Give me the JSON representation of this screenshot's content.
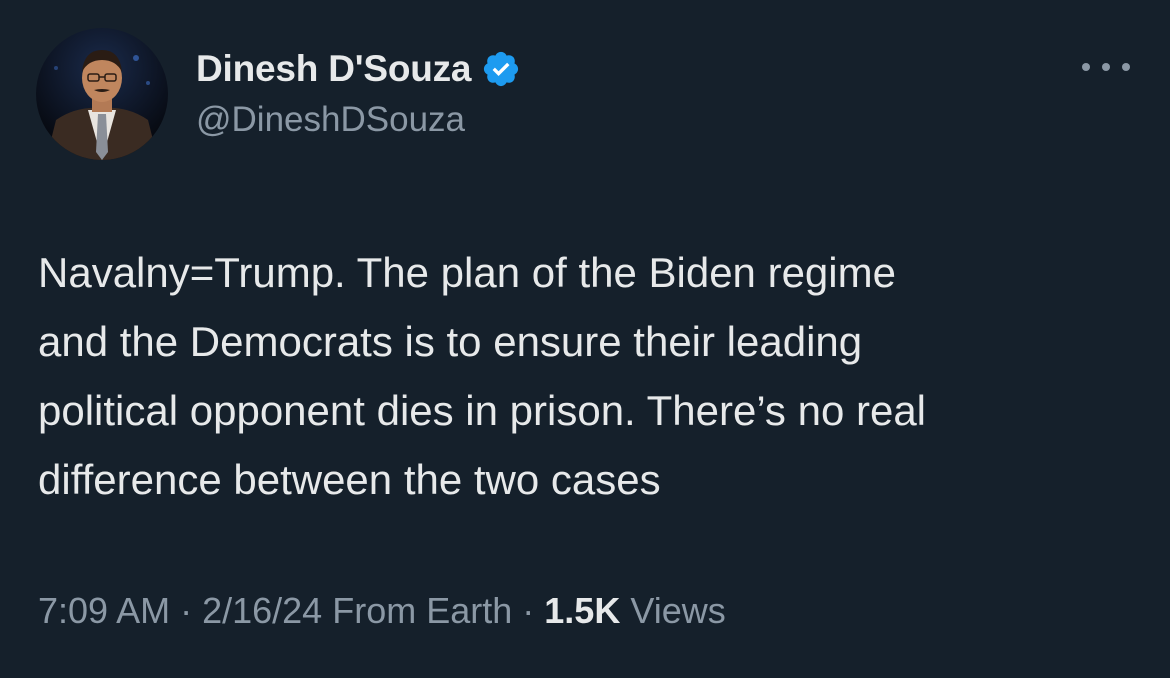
{
  "author": {
    "display_name": "Dinesh D'Souza",
    "handle": "@DineshDSouza",
    "verified": true,
    "verified_color": "#1d9bf0"
  },
  "tweet": {
    "lines": [
      "Navalny=Trump. The plan of the Biden regime",
      "and the Democrats is to ensure their leading",
      "political opponent dies in prison. There’s no real",
      "difference between the two cases"
    ]
  },
  "meta": {
    "time": "7:09 AM",
    "date": "2/16/24",
    "source": "From Earth",
    "separator": "·",
    "views_count": "1.5K",
    "views_label": "Views"
  },
  "icons": {
    "more": "more-horizontal-icon",
    "verified": "verified-badge-icon"
  },
  "colors": {
    "background": "#15202b",
    "primary_text": "#e7e9ea",
    "secondary_text": "#8b98a5"
  }
}
